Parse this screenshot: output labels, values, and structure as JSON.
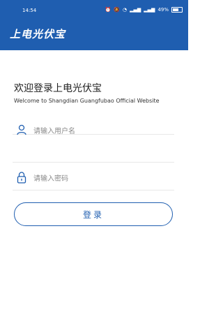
{
  "status_bar": {
    "time": "14:54",
    "battery": "49%"
  },
  "header": {
    "title": "上电光伏宝"
  },
  "welcome": {
    "title": "欢迎登录上电光伏宝",
    "subtitle": "Welcome to Shangdian Guangfubao Official Website"
  },
  "form": {
    "username_placeholder": "请输入用户名",
    "password_placeholder": "请输入密码",
    "login_label": "登录"
  },
  "colors": {
    "brand": "#1f5eb0",
    "placeholder": "#8a8a8a",
    "divider": "#e8e8e8"
  },
  "icons": {
    "username": "user-icon",
    "password": "lock-icon"
  }
}
